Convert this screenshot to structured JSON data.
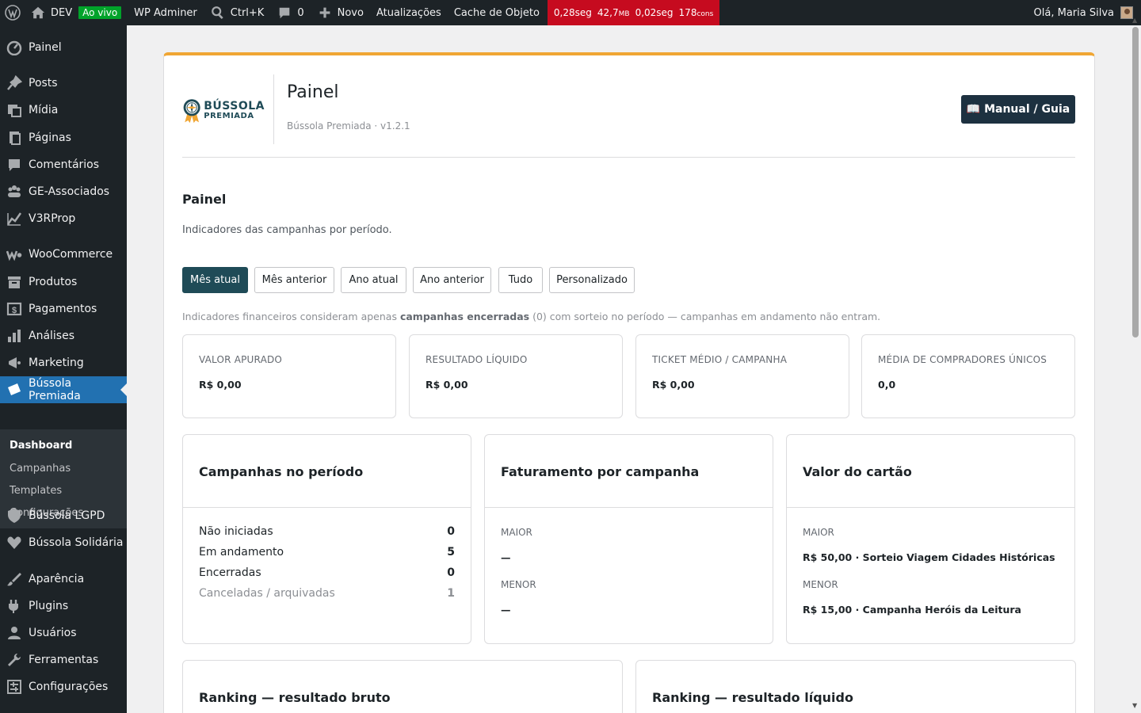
{
  "adminbar": {
    "site_name": "DEV",
    "live_badge": "Ao vivo",
    "adminer": "WP Adminer",
    "search_shortcut": "Ctrl+K",
    "comments_count": "0",
    "new_label": "Novo",
    "updates_label": "Atualizações",
    "cache_label": "Cache de Objeto",
    "qm": {
      "time1": "0,28seg",
      "mem": "42,7",
      "mem_unit": "MB",
      "time2": "0,02seg",
      "queries": "178",
      "queries_unit": "cons",
      "color": "#c60b1f"
    },
    "greeting": "Olá, Maria Silva"
  },
  "sidebar": {
    "items": [
      {
        "label": "Painel",
        "icon": "dashboard-icon"
      },
      {
        "label": "Posts",
        "icon": "pin-icon"
      },
      {
        "label": "Mídia",
        "icon": "media-icon"
      },
      {
        "label": "Páginas",
        "icon": "pages-icon"
      },
      {
        "label": "Comentários",
        "icon": "comment-icon"
      },
      {
        "label": "GE-Associados",
        "icon": "groups-icon"
      },
      {
        "label": "V3RProp",
        "icon": "chart-line-icon"
      },
      {
        "label": "WooCommerce",
        "icon": "woo-icon"
      },
      {
        "label": "Produtos",
        "icon": "archive-icon"
      },
      {
        "label": "Pagamentos",
        "icon": "payments-icon"
      },
      {
        "label": "Análises",
        "icon": "bar-chart-icon"
      },
      {
        "label": "Marketing",
        "icon": "megaphone-icon"
      },
      {
        "label": "Bússola Premiada",
        "icon": "tickets-icon"
      },
      {
        "label": "Bússola LGPD",
        "icon": "shield-icon"
      },
      {
        "label": "Bússola Solidária",
        "icon": "heart-icon"
      },
      {
        "label": "Aparência",
        "icon": "brush-icon"
      },
      {
        "label": "Plugins",
        "icon": "plugin-icon"
      },
      {
        "label": "Usuários",
        "icon": "user-icon"
      },
      {
        "label": "Ferramentas",
        "icon": "wrench-icon"
      },
      {
        "label": "Configurações",
        "icon": "settings-icon"
      }
    ],
    "submenu": [
      "Dashboard",
      "Campanhas",
      "Templates",
      "Configurações"
    ],
    "accent": "#2271b1"
  },
  "header": {
    "logo_line1": "BÚSSOLA",
    "logo_line2": "PREMIADA",
    "title": "Painel",
    "subtitle": "Bússola Premiada · v1.2.1",
    "manual_button": "📖 Manual / Guia"
  },
  "section": {
    "title": "Painel",
    "description": "Indicadores das campanhas por período."
  },
  "periods": {
    "options": [
      "Mês atual",
      "Mês anterior",
      "Ano atual",
      "Ano anterior",
      "Tudo",
      "Personalizado"
    ],
    "selected": "Mês atual"
  },
  "note": {
    "before": "Indicadores financeiros consideram apenas ",
    "strong": "campanhas encerradas",
    "after": " (0) com sorteio no período — campanhas em andamento não entram."
  },
  "kpis": [
    {
      "label": "Valor apurado",
      "value": "R$ 0,00"
    },
    {
      "label": "Resultado líquido",
      "value": "R$ 0,00"
    },
    {
      "label": "Ticket médio / campanha",
      "value": "R$ 0,00"
    },
    {
      "label": "Média de compradores únicos",
      "value": "0,0"
    }
  ],
  "campaigns_panel": {
    "title": "Campanhas no período",
    "rows": [
      {
        "label": "Não iniciadas",
        "value": "0"
      },
      {
        "label": "Em andamento",
        "value": "5"
      },
      {
        "label": "Encerradas",
        "value": "0"
      },
      {
        "label": "Canceladas / arquivadas",
        "value": "1"
      }
    ]
  },
  "billing_panel": {
    "title": "Faturamento por campanha",
    "max_label": "Maior",
    "max_value": "—",
    "min_label": "Menor",
    "min_value": "—"
  },
  "card_panel": {
    "title": "Valor do cartão",
    "max_label": "Maior",
    "max_value": "R$ 50,00 · Sorteio Viagem Cidades Históricas",
    "min_label": "Menor",
    "min_value": "R$ 15,00 · Campanha Heróis da Leitura"
  },
  "rankings": [
    {
      "title": "Ranking — resultado bruto"
    },
    {
      "title": "Ranking — resultado líquido"
    }
  ]
}
